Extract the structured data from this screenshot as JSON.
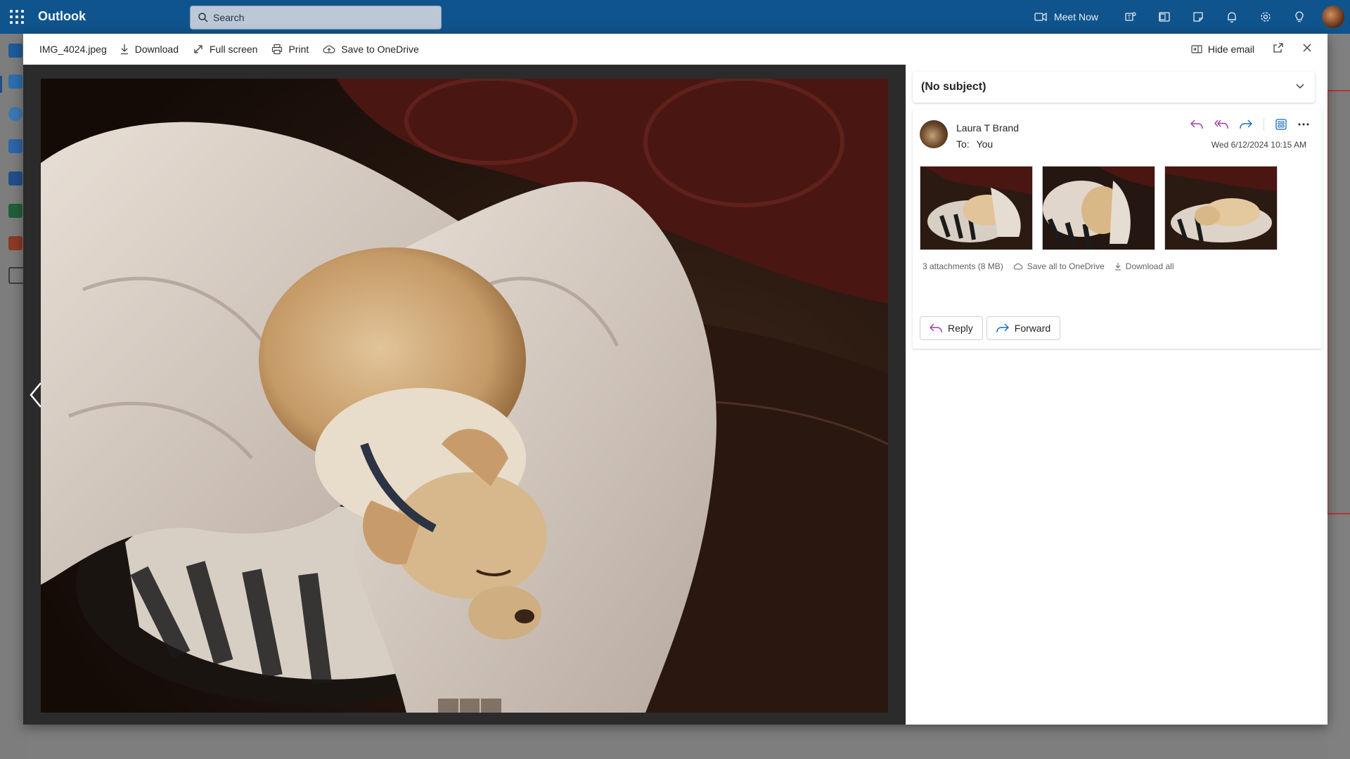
{
  "app": {
    "name": "Outlook"
  },
  "search": {
    "placeholder": "Search"
  },
  "topbar": {
    "meet_now": "Meet Now"
  },
  "viewer": {
    "file_name": "IMG_4024.jpeg",
    "toolbar": {
      "download": "Download",
      "full_screen": "Full screen",
      "print": "Print",
      "save_onedrive": "Save to OneDrive",
      "hide_email": "Hide email"
    }
  },
  "email": {
    "subject": "(No subject)",
    "sender": "Laura T Brand",
    "to_label": "To:",
    "to_value": "You",
    "date": "Wed 6/12/2024 10:15 AM",
    "attachments_info": "3 attachments (8 MB)",
    "save_all": "Save all to OneDrive",
    "download_all": "Download all",
    "reply": "Reply",
    "forward": "Forward"
  },
  "colors": {
    "brand_bar": "#0f548c",
    "reply_accent": "#a33aa3",
    "forward_accent": "#0f6cbd"
  }
}
